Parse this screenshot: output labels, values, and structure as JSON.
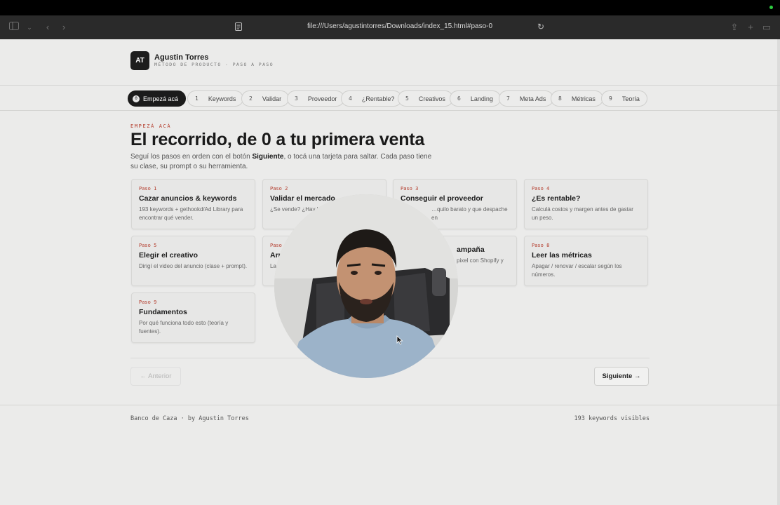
{
  "browser": {
    "url": "file:///Users/agustintorres/Downloads/index_15.html#paso-0"
  },
  "brand": {
    "initials": "AT",
    "name": "Agustin Torres",
    "subtitle": "MÉTODO DE PRODUCTO · PASO A PASO"
  },
  "nav": {
    "steps": [
      {
        "num": "0",
        "label": "Empezá acá"
      },
      {
        "num": "1",
        "label": "Keywords"
      },
      {
        "num": "2",
        "label": "Validar"
      },
      {
        "num": "3",
        "label": "Proveedor"
      },
      {
        "num": "4",
        "label": "¿Rentable?"
      },
      {
        "num": "5",
        "label": "Creativos"
      },
      {
        "num": "6",
        "label": "Landing"
      },
      {
        "num": "7",
        "label": "Meta Ads"
      },
      {
        "num": "8",
        "label": "Métricas"
      },
      {
        "num": "9",
        "label": "Teoría"
      }
    ],
    "active_index": 0
  },
  "hero": {
    "kicker": "EMPEZÁ ACÁ",
    "title": "El recorrido, de 0 a tu primera venta",
    "intro_before": "Seguí los pasos en orden con el botón ",
    "intro_bold": "Siguiente",
    "intro_after": ", o tocá una tarjeta para saltar. Cada paso tiene su clase, su prompt o su herramienta."
  },
  "cards": [
    {
      "paso": "Paso 1",
      "title": "Cazar anuncios & keywords",
      "desc": "193 keywords + gethookd/Ad Library para encontrar qué vender."
    },
    {
      "paso": "Paso 2",
      "title": "Validar el mercado",
      "desc": "¿Se vende? ¿Hay la oferta y reseñ"
    },
    {
      "paso": "Paso 3",
      "title": "Conseguir el proveedor",
      "desc": "…quilo barato y que despache en"
    },
    {
      "paso": "Paso 4",
      "title": "¿Es rentable?",
      "desc": "Calculá costos y margen antes de gastar un peso."
    },
    {
      "paso": "Paso 5",
      "title": "Elegir el creativo",
      "desc": "Dirigí el video del anuncio (clase + prompt)."
    },
    {
      "paso": "Paso",
      "title": "Arm",
      "desc": "La"
    },
    {
      "paso": "",
      "title": "ampaña",
      "desc": "pixel con Shopify y"
    },
    {
      "paso": "Paso 8",
      "title": "Leer las métricas",
      "desc": "Apagar / renovar / escalar según los números."
    },
    {
      "paso": "Paso 9",
      "title": "Fundamentos",
      "desc": "Por qué funciona todo esto (teoría y fuentes)."
    }
  ],
  "buttons": {
    "prev": "← Anterior",
    "next": "Siguiente →"
  },
  "footer": {
    "left": "Banco de Caza · by Agustin Torres",
    "right": "193 keywords visibles"
  },
  "colors": {
    "accent": "#b33a2a",
    "page_bg": "#ebebea",
    "dark": "#1b1b1b"
  }
}
